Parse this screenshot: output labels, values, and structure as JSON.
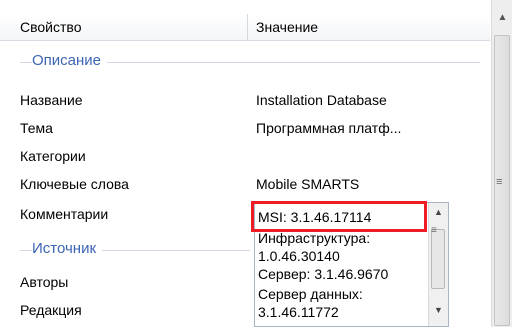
{
  "header": {
    "property_label": "Свойство",
    "value_label": "Значение"
  },
  "groups": {
    "description": {
      "title": "Описание"
    },
    "source": {
      "title": "Источник"
    }
  },
  "rows": [
    {
      "name": "Название",
      "value": "Installation Database"
    },
    {
      "name": "Тема",
      "value": "Программная платф..."
    },
    {
      "name": "Категории",
      "value": ""
    },
    {
      "name": "Ключевые слова",
      "value": "Mobile SMARTS"
    },
    {
      "name": "Комментарии",
      "value": ""
    }
  ],
  "source_rows": [
    {
      "name": "Авторы"
    },
    {
      "name": "Редакция"
    }
  ],
  "comment_editor": {
    "lines": [
      "MSI: 3.1.46.17114",
      "Инфраструктура:",
      "1.0.46.30140",
      "Сервер: 3.1.46.9670",
      "Сервер данных:",
      "3.1.46.11772"
    ]
  },
  "icons": {
    "scroll_up": "chevron-up-icon",
    "scroll_down": "chevron-down-icon",
    "grip": "grip-icon"
  },
  "colors": {
    "highlight": "#ee1c25",
    "group_title": "#3c64b4"
  }
}
